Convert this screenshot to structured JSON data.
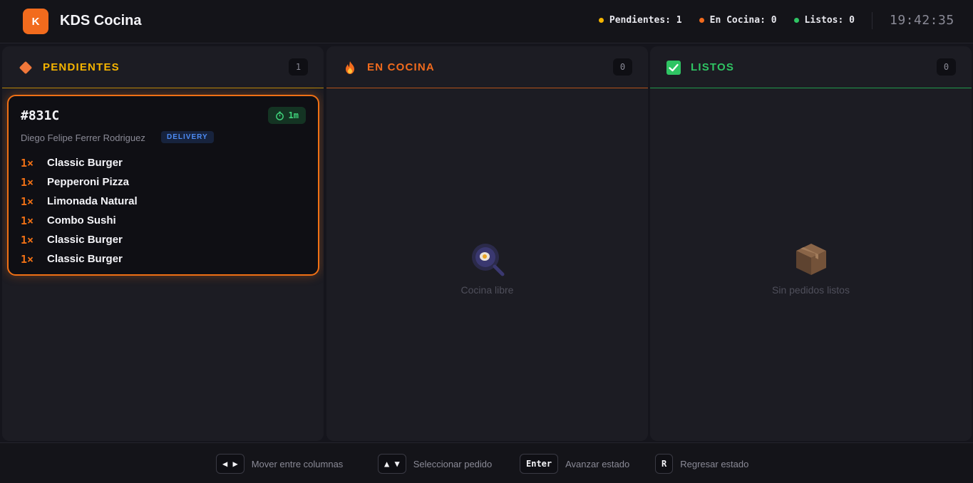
{
  "header": {
    "logo_letter": "K",
    "title": "KDS Cocina",
    "stats": [
      {
        "label": "Pendientes: 1",
        "color": "#f5b400"
      },
      {
        "label": "En Cocina: 0",
        "color": "#f26b1d"
      },
      {
        "label": "Listos: 0",
        "color": "#2fc463"
      }
    ],
    "clock": "19:42:35"
  },
  "columns": [
    {
      "title": "PENDIENTES",
      "count": "1",
      "color": "#f5b400",
      "icon": "diamond-icon"
    },
    {
      "title": "EN COCINA",
      "count": "0",
      "color": "#f26b1d",
      "icon": "fire-icon"
    },
    {
      "title": "LISTOS",
      "count": "0",
      "color": "#2fc463",
      "icon": "checkbox-icon"
    }
  ],
  "order": {
    "id": "#831C",
    "elapsed": "1m",
    "customer": "Diego Felipe Ferrer Rodriguez",
    "type": "DELIVERY",
    "items": [
      {
        "qty": "1×",
        "name": "Classic Burger"
      },
      {
        "qty": "1×",
        "name": "Pepperoni Pizza"
      },
      {
        "qty": "1×",
        "name": "Limonada Natural"
      },
      {
        "qty": "1×",
        "name": "Combo Sushi"
      },
      {
        "qty": "1×",
        "name": "Classic Burger"
      },
      {
        "qty": "1×",
        "name": "Classic Burger"
      }
    ]
  },
  "empty_states": {
    "cocina": {
      "text": "Cocina libre",
      "icon": "frying-pan-icon"
    },
    "listos": {
      "text": "Sin pedidos listos",
      "icon": "package-icon"
    }
  },
  "footer": {
    "hints": [
      {
        "key": "◀ ▶",
        "label": "Mover entre columnas"
      },
      {
        "key": "▲ ▼",
        "label": "Seleccionar pedido"
      },
      {
        "key": "Enter",
        "label": "Avanzar estado"
      },
      {
        "key": "R",
        "label": "Regresar estado"
      }
    ]
  }
}
